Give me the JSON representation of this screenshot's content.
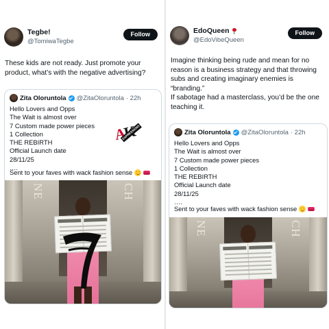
{
  "left_tweet": {
    "author": {
      "name": "Tegbe!",
      "handle": "@TomiwaTegbe",
      "avatar_icon": "profile-photo"
    },
    "follow_label": "Follow",
    "text": "These kids are not ready. Just promote your product, what’s with the negative advertising?",
    "quote": {
      "author": {
        "name": "Zita Oloruntola",
        "handle": "@ZitaOloruntola",
        "time": "· 22h",
        "verified": true
      },
      "lines": "Hello Lovers and Opps\nThe Wait is almost over\n7 Custom made power pieces\n1 Collection\nTHE REBIRTH\nOfficial Launch date\n28/11/25\n….",
      "last_line": "Sent to your faves with wack fashion sense",
      "photo_wall_left": "NE",
      "photo_wall_right": "CH"
    },
    "watermark": {
      "text_a": "A",
      "text_k": "K",
      "badge": "EXPRESSIONS"
    }
  },
  "right_tweet": {
    "author": {
      "name": "EdoQueen",
      "handle": "@EdoVibeQueen",
      "avatar_icon": "profile-photo",
      "name_emoji": "rose-icon"
    },
    "follow_label": "Follow",
    "text": "Imagine thinking being rude and mean for no reason is a business strategy and that throwing subs and creating imaginary enemies is “branding.”\nIf sabotage had a masterclass, you’d be the one teaching it.",
    "quote": {
      "author": {
        "name": "Zita Oloruntola",
        "handle": "@ZitaOloruntola",
        "time": "· 22h",
        "verified": true
      },
      "lines": "Hello Lovers and Opps\nThe Wait is almost over\n7 Custom made power pieces\n1 Collection\nTHE REBIRTH\nOfficial Launch date\n28/11/25\n….",
      "last_line": "Sent to your faves with wack fashion sense",
      "photo_wall_left": "NE",
      "photo_wall_right": "CH"
    }
  },
  "colors": {
    "follow_bg": "#0f1419",
    "verified": "#1d9bf0",
    "dress": "#f28fb0",
    "secondary_text": "#536471"
  }
}
